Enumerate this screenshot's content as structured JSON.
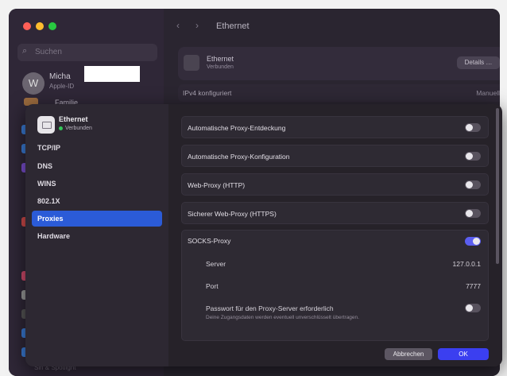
{
  "back_window": {
    "search_placeholder": "Suchen",
    "user": {
      "initial": "W",
      "name": "Micha",
      "subtitle": "Apple-ID"
    },
    "family_label": "Familie",
    "title": "Ethernet",
    "nav_back": "‹",
    "nav_forward": "›",
    "ethernet_card": {
      "title": "Ethernet",
      "status": "Verbunden",
      "details_button": "Details …"
    },
    "ipv4": {
      "label": "IPv4 konfiguriert",
      "value": "Manuell"
    },
    "bottom_text": "Siri & Spotlight"
  },
  "sheet": {
    "interface": {
      "title": "Ethernet",
      "status": "Verbunden",
      "status_color": "#34c759"
    },
    "nav": [
      {
        "label": "TCP/IP",
        "active": false
      },
      {
        "label": "DNS",
        "active": false
      },
      {
        "label": "WINS",
        "active": false
      },
      {
        "label": "802.1X",
        "active": false
      },
      {
        "label": "Proxies",
        "active": true
      },
      {
        "label": "Hardware",
        "active": false
      }
    ],
    "proxies": [
      {
        "label": "Automatische Proxy-Entdeckung",
        "on": false
      },
      {
        "label": "Automatische Proxy-Konfiguration",
        "on": false
      },
      {
        "label": "Web-Proxy (HTTP)",
        "on": false
      },
      {
        "label": "Sicherer Web-Proxy (HTTPS)",
        "on": false
      }
    ],
    "socks": {
      "label": "SOCKS-Proxy",
      "on": true,
      "server_label": "Server",
      "server_value": "127.0.0.1",
      "port_label": "Port",
      "port_value": "7777",
      "password_label": "Passwort für den Proxy-Server erforderlich",
      "password_hint": "Deine Zugangsdaten werden eventuell unverschlüsselt übertragen.",
      "password_on": false
    },
    "buttons": {
      "cancel": "Abbrechen",
      "ok": "OK"
    },
    "accent_color": "#2b5bd7"
  }
}
